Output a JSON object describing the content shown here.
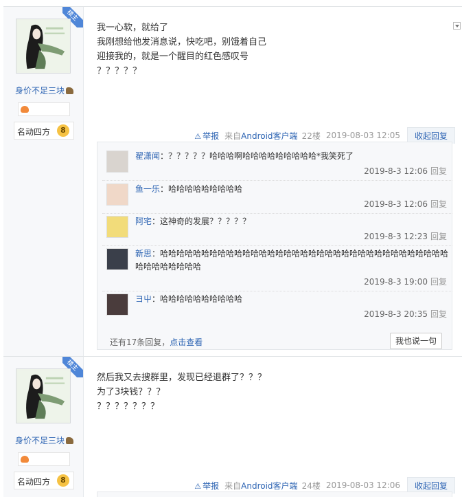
{
  "posts": [
    {
      "badge": "楼主",
      "author": "身价不足三块",
      "level_name": "名动四方",
      "level_num": "8",
      "lines": [
        "我一心软，就给了",
        "我刚想给他发消息说，快吃吧，别饿着自己",
        "迎接我的，就是一个醒目的红色感叹号",
        "？？？？？"
      ],
      "meta": {
        "report": "举报",
        "source_prefix": "来自",
        "source": "Android客户端",
        "floor": "22楼",
        "date": "2019-08-03 12:05",
        "collapse": "收起回复"
      },
      "replies": [
        {
          "name": "翟潇闻",
          "text": "：？？？？？哈哈哈啊哈哈哈哈哈哈哈哈哈*我笑死了",
          "time": "2019-8-3 12:06",
          "reply": "回复",
          "avatar_color": "#d9d4cf"
        },
        {
          "name": "鱼一乐",
          "text": "：哈哈哈哈哈哈哈哈哈",
          "time": "2019-8-3 12:06",
          "reply": "回复",
          "avatar_color": "#f0d8c8"
        },
        {
          "name": "阿宅",
          "text": "：这神奇的发展？？？？？",
          "time": "2019-8-3 12:23",
          "reply": "回复",
          "avatar_color": "#f2dc7a"
        },
        {
          "name": "新思",
          "text": "：哈哈哈哈哈哈哈哈哈哈哈哈哈哈哈哈哈哈哈哈哈哈哈哈哈哈哈哈哈哈哈哈哈哈哈哈哈哈哈哈哈哈哈",
          "time": "2019-8-3 19:00",
          "reply": "回复",
          "avatar_color": "#3a3f4a"
        },
        {
          "name": "ヨ屮",
          "text": "：哈哈哈哈哈哈哈哈哈哈",
          "time": "2019-8-3 20:35",
          "reply": "回复",
          "avatar_color": "#4a3c3c"
        }
      ],
      "more_prefix": "还有17条回复，",
      "more_link": "点击查看",
      "say_button": "我也说一句"
    },
    {
      "badge": "楼主",
      "author": "身价不足三块",
      "level_name": "名动四方",
      "level_num": "8",
      "lines": [
        "然后我又去搜群里，发现已经退群了？？？",
        "为了3块钱？？？",
        "？？？？？？？"
      ],
      "meta": {
        "report": "举报",
        "source_prefix": "来自",
        "source": "Android客户端",
        "floor": "24楼",
        "date": "2019-08-03 12:06",
        "collapse": "收起回复"
      }
    }
  ]
}
